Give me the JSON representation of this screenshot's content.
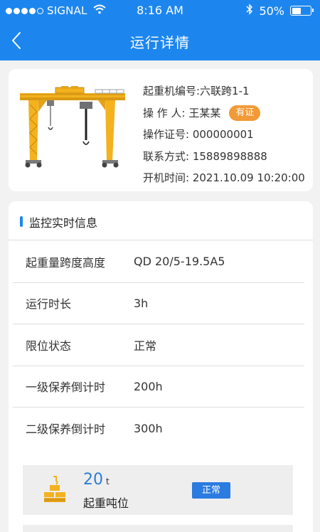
{
  "status_bar": {
    "carrier": "SIGNAL",
    "time": "8:16 AM",
    "battery": "50%",
    "battery_level": 0.5
  },
  "nav": {
    "title": "运行详情"
  },
  "crane_info": {
    "id_line": "起重机编号:六联跨1-1",
    "operator_line": "操 作 人: 王某某",
    "certificate_badge": "有证",
    "cert_no_line": "操作证号: 000000001",
    "contact_line": "联系方式: 15889898888",
    "start_time_line": "开机时间: 2021.10.09 10:20:00"
  },
  "monitor": {
    "section_title": "监控实时信息",
    "rows": [
      {
        "label": "起重量跨度高度",
        "value": "QD 20/5-19.5A5"
      },
      {
        "label": "运行时长",
        "value": "3h"
      },
      {
        "label": "限位状态",
        "value": "正常"
      },
      {
        "label": "一级保养倒计时",
        "value": "200h"
      },
      {
        "label": "二级保养倒计时",
        "value": "300h"
      }
    ]
  },
  "tonnage": {
    "value": "20",
    "unit": "t",
    "label": "起重吨位",
    "status": "正常"
  },
  "colors": {
    "primary": "#1d86ee",
    "badge_orange": "#f29a36",
    "crane_yellow": "#f3b21e"
  },
  "icons": [
    "signal-dots",
    "wifi-icon",
    "bluetooth-icon",
    "battery-icon",
    "back-arrow-icon",
    "crane-illustration",
    "weight-icon"
  ]
}
